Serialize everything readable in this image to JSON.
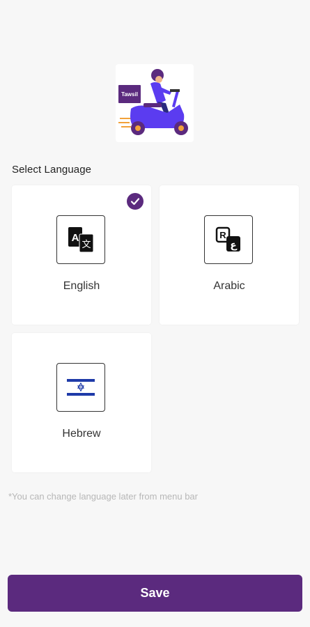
{
  "header": {
    "logo_text": "Tawsil"
  },
  "language_section": {
    "title": "Select Language",
    "languages": [
      {
        "label": "English",
        "icon": "translate-icon",
        "selected": true
      },
      {
        "label": "Arabic",
        "icon": "alphabet-icon",
        "selected": false
      },
      {
        "label": "Hebrew",
        "icon": "israel-flag-icon",
        "selected": false
      }
    ]
  },
  "hint": "*You can change language later from menu bar",
  "save_button": {
    "label": "Save"
  },
  "colors": {
    "accent": "#5b2a7e",
    "scooter": "#5b3cf0",
    "wheel_hub": "#f2a13a",
    "background": "#f7f7f7"
  }
}
